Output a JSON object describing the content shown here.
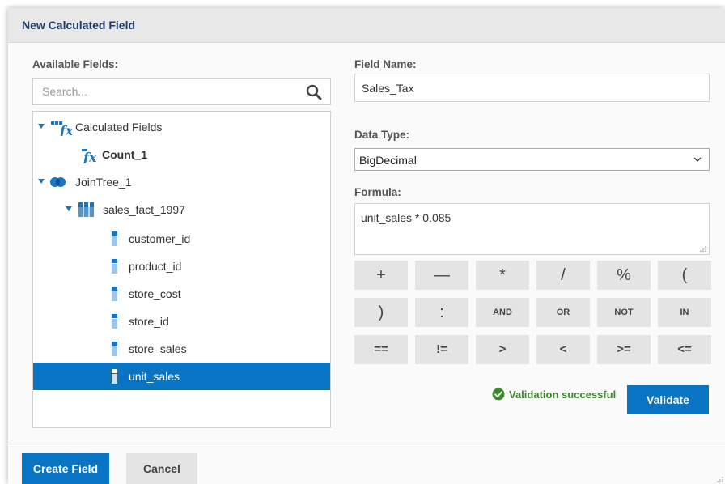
{
  "dialog": {
    "title": "New Calculated Field"
  },
  "available_fields": {
    "label": "Available Fields:",
    "search_placeholder": "Search...",
    "tree": [
      {
        "label": "Calculated Fields",
        "level": 0,
        "expanded": true,
        "icon": "function-folder-icon",
        "bold": false,
        "selected": false
      },
      {
        "label": "Count_1",
        "level": 1,
        "icon": "function-icon",
        "bold": true,
        "selected": false
      },
      {
        "label": "JoinTree_1",
        "level": 0,
        "expanded": true,
        "icon": "join-icon",
        "bold": false,
        "selected": false
      },
      {
        "label": "sales_fact_1997",
        "level": 1,
        "expanded": true,
        "icon": "table-icon",
        "bold": false,
        "selected": false
      },
      {
        "label": "customer_id",
        "level": 2,
        "icon": "column-icon",
        "bold": false,
        "selected": false
      },
      {
        "label": "product_id",
        "level": 2,
        "icon": "column-icon",
        "bold": false,
        "selected": false
      },
      {
        "label": "store_cost",
        "level": 2,
        "icon": "column-icon",
        "bold": false,
        "selected": false
      },
      {
        "label": "store_id",
        "level": 2,
        "icon": "column-icon",
        "bold": false,
        "selected": false
      },
      {
        "label": "store_sales",
        "level": 2,
        "icon": "column-icon",
        "bold": false,
        "selected": false
      },
      {
        "label": "unit_sales",
        "level": 2,
        "icon": "column-icon",
        "bold": false,
        "selected": true
      }
    ]
  },
  "field_name": {
    "label": "Field Name:",
    "value": "Sales_Tax"
  },
  "data_type": {
    "label": "Data Type:",
    "selected": "BigDecimal"
  },
  "formula": {
    "label": "Formula:",
    "value": "unit_sales * 0.085"
  },
  "operators": [
    [
      "+",
      "—",
      "*",
      "/",
      "%",
      "("
    ],
    [
      ")",
      ":",
      "AND",
      "OR",
      "NOT",
      "IN"
    ],
    [
      "==",
      "!=",
      ">",
      "<",
      ">=",
      "<="
    ]
  ],
  "validation": {
    "message": "Validation successful",
    "button": "Validate",
    "status_color": "#3a8a2a"
  },
  "footer": {
    "create_label": "Create Field",
    "cancel_label": "Cancel"
  },
  "colors": {
    "accent": "#0a74c4",
    "title": "#1a3d6e"
  }
}
